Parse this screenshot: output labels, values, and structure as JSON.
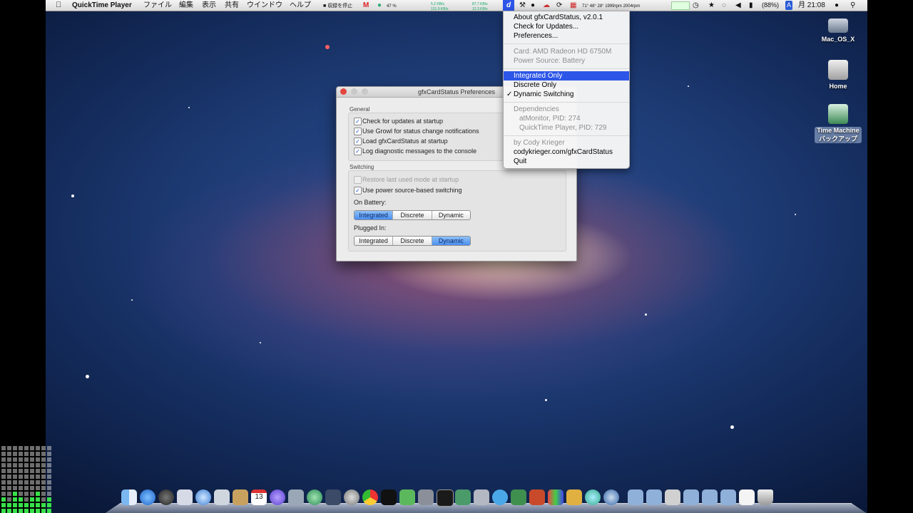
{
  "menubar": {
    "app_name": "QuickTime Player",
    "menus": [
      "ファイル",
      "編集",
      "表示",
      "共有",
      "ウインドウ",
      "ヘルプ"
    ],
    "record_label": "収録を停止",
    "cpu_percent": "47 %",
    "net_up": "5.2 KB/s",
    "net_down": "131.9 KB/s",
    "disk_read": "87.7 KB/s",
    "disk_write": "12.3 KB/s",
    "sensors": "71° 48° 28° 1999rpm 2004rpm",
    "battery": "(88%)",
    "clock": "月 21:08",
    "input_letter": "A",
    "gfx_letter": "d"
  },
  "dropdown": {
    "about": "About gfxCardStatus, v2.0.1",
    "check_updates": "Check for Updates...",
    "preferences": "Preferences...",
    "card": "Card: AMD Radeon HD 6750M",
    "power_source": "Power Source: Battery",
    "integrated_only": "Integrated Only",
    "discrete_only": "Discrete Only",
    "dynamic_switching": "Dynamic Switching",
    "dependencies": "Dependencies",
    "dep1": "atMonitor, PID: 274",
    "dep2": "QuickTime Player, PID: 729",
    "by": "by Cody Krieger",
    "website": "codykrieger.com/gfxCardStatus",
    "quit": "Quit",
    "checkmark": "✓"
  },
  "prefs": {
    "title": "gfxCardStatus Preferences",
    "general_label": "General",
    "general": [
      {
        "label": "Check for updates at startup",
        "checked": true
      },
      {
        "label": "Use Growl for status change notifications",
        "checked": true
      },
      {
        "label": "Load gfxCardStatus at startup",
        "checked": true
      },
      {
        "label": "Log diagnostic messages to the console",
        "checked": true
      }
    ],
    "switching_label": "Switching",
    "restore": "Restore last used mode at startup",
    "power_switch": "Use power source-based switching",
    "on_battery": "On Battery:",
    "plugged_in": "Plugged In:",
    "seg_integrated": "Integrated",
    "seg_discrete": "Discrete",
    "seg_dynamic": "Dynamic",
    "battery_selected": "Integrated",
    "plugged_selected": "Dynamic",
    "check": "✓"
  },
  "desktop": {
    "hd_label": "Mac_OS_X",
    "home_label": "Home",
    "tm_label1": "Time Machine",
    "tm_label2": "バックアップ"
  },
  "dock": {
    "calendar_day": "13"
  },
  "colors": {
    "menu_highlight": "#2d56e8",
    "segment_on": "#4b8ff0",
    "meter_green": "#38e04a"
  }
}
